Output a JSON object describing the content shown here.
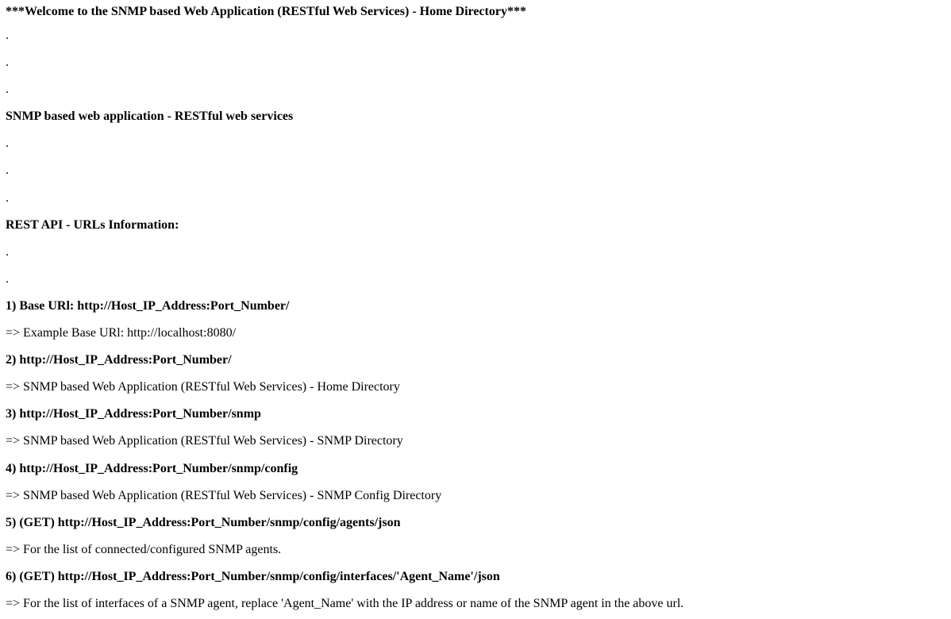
{
  "page": {
    "lines": [
      {
        "text": "***Welcome to the SNMP based Web Application (RESTful Web Services) - Home Directory***",
        "bold": true
      },
      {
        "text": ".",
        "bold": false
      },
      {
        "text": ".",
        "bold": false
      },
      {
        "text": ".",
        "bold": false
      },
      {
        "text": "SNMP based web application - RESTful web services",
        "bold": true
      },
      {
        "text": ".",
        "bold": false
      },
      {
        "text": ".",
        "bold": false
      },
      {
        "text": ".",
        "bold": false
      },
      {
        "text": "REST API - URLs Information:",
        "bold": true
      },
      {
        "text": ".",
        "bold": false
      },
      {
        "text": ".",
        "bold": false
      },
      {
        "text": "1) Base URl: http://Host_IP_Address:Port_Number/",
        "bold": true
      },
      {
        "text": "=> Example Base URl: http://localhost:8080/",
        "bold": false
      },
      {
        "text": "2) http://Host_IP_Address:Port_Number/",
        "bold": true
      },
      {
        "text": "=> SNMP based Web Application (RESTful Web Services) - Home Directory",
        "bold": false
      },
      {
        "text": "3) http://Host_IP_Address:Port_Number/snmp",
        "bold": true
      },
      {
        "text": "=> SNMP based Web Application (RESTful Web Services) - SNMP Directory",
        "bold": false
      },
      {
        "text": "4) http://Host_IP_Address:Port_Number/snmp/config",
        "bold": true
      },
      {
        "text": "=> SNMP based Web Application (RESTful Web Services) - SNMP Config Directory",
        "bold": false
      },
      {
        "text": "5) (GET) http://Host_IP_Address:Port_Number/snmp/config/agents/json",
        "bold": true
      },
      {
        "text": "=> For the list of connected/configured SNMP agents.",
        "bold": false
      },
      {
        "text": "6) (GET) http://Host_IP_Address:Port_Number/snmp/config/interfaces/'Agent_Name'/json",
        "bold": true
      },
      {
        "text": "=> For the list of interfaces of a SNMP agent, replace 'Agent_Name' with the IP address or name of the SNMP agent in the above url.",
        "bold": false
      }
    ]
  }
}
